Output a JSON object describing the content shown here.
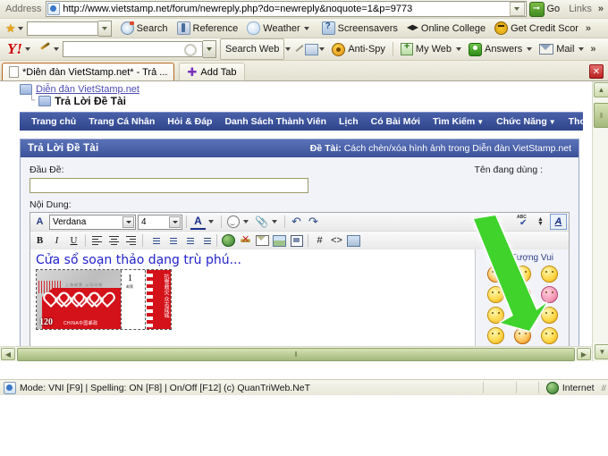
{
  "browser": {
    "address_label": "Address",
    "url": "http://www.vietstamp.net/forum/newreply.php?do=newreply&noquote=1&p=9773",
    "go_label": "Go",
    "links_label": "Links",
    "overflow_label": "»"
  },
  "links_toolbar": {
    "items": [
      {
        "label": "Search",
        "icon": "search-icon"
      },
      {
        "label": "Reference",
        "icon": "reference-icon"
      },
      {
        "label": "Weather",
        "icon": "weather-icon"
      },
      {
        "label": "Screensavers",
        "icon": "screensavers-icon"
      },
      {
        "label": "Online College",
        "icon": "graduation-cap-icon"
      },
      {
        "label": "Get Credit Scor",
        "icon": "bee-icon"
      }
    ]
  },
  "yahoo_toolbar": {
    "logo": "Y!",
    "search_placeholder": "",
    "search_value": "",
    "search_web_label": "Search Web",
    "items": [
      {
        "label": "Anti-Spy",
        "icon": "anti-spy-icon"
      },
      {
        "label": "My Web",
        "icon": "my-web-icon"
      },
      {
        "label": "Answers",
        "icon": "answers-icon"
      },
      {
        "label": "Mail",
        "icon": "mail-icon"
      }
    ],
    "overflow_label": "»"
  },
  "tabs": {
    "active_tab": "*Diễn đàn VietStamp.net* - Trả ...",
    "add_tab_label": "Add Tab",
    "close_label": "✕"
  },
  "breadcrumb": {
    "parent": "Diễn đàn VietStamp.net",
    "current": "Trả Lời Đề Tài"
  },
  "forum_nav": [
    {
      "label": "Trang chủ",
      "caret": false
    },
    {
      "label": "Trang Cá Nhân",
      "caret": false
    },
    {
      "label": "Hỏi & Đáp",
      "caret": false
    },
    {
      "label": "Danh Sách Thành Viên",
      "caret": false
    },
    {
      "label": "Lịch",
      "caret": false
    },
    {
      "label": "Có Bài Mới",
      "caret": false
    },
    {
      "label": "Tìm Kiếm",
      "caret": true
    },
    {
      "label": "Chức Năng",
      "caret": true
    },
    {
      "label": "Thoát",
      "caret": false
    }
  ],
  "panel": {
    "title": "Trả Lời Đề Tài",
    "topic_prefix": "Đề Tài:",
    "topic_name": "Cách chèn/xóa hình ảnh trong Diễn đàn VietStamp.net",
    "title_field_label": "Đầu Đề:",
    "title_field_value": "",
    "username_label": "Tên đang dùng :",
    "content_label": "Nội Dung:"
  },
  "editor": {
    "font_family": "Verdana",
    "font_size": "4",
    "toolbar_row1": [
      {
        "name": "font-style-icon",
        "glyph": "А"
      },
      {
        "name": "font-family-select",
        "glyph": ""
      },
      {
        "name": "font-size-select",
        "glyph": ""
      },
      {
        "name": "text-color-icon",
        "glyph": "A"
      },
      {
        "name": "smiley-icon",
        "glyph": ""
      },
      {
        "name": "attachment-icon",
        "glyph": "✂"
      },
      {
        "name": "undo-icon",
        "glyph": "↶"
      },
      {
        "name": "redo-icon",
        "glyph": "↷"
      }
    ],
    "toolbar_row2": [
      {
        "name": "bold-button",
        "glyph": "B"
      },
      {
        "name": "italic-button",
        "glyph": "I"
      },
      {
        "name": "underline-button",
        "glyph": "U"
      },
      {
        "name": "align-left-button",
        "glyph": ""
      },
      {
        "name": "align-center-button",
        "glyph": ""
      },
      {
        "name": "align-right-button",
        "glyph": ""
      },
      {
        "name": "ordered-list-button",
        "glyph": ""
      },
      {
        "name": "unordered-list-button",
        "glyph": ""
      },
      {
        "name": "outdent-button",
        "glyph": ""
      },
      {
        "name": "indent-button",
        "glyph": ""
      },
      {
        "name": "insert-link-button",
        "glyph": ""
      },
      {
        "name": "remove-link-button",
        "glyph": ""
      },
      {
        "name": "insert-email-button",
        "glyph": ""
      },
      {
        "name": "insert-image-button",
        "glyph": ""
      },
      {
        "name": "quote-button",
        "glyph": ""
      },
      {
        "name": "code-hash-button",
        "glyph": "#"
      },
      {
        "name": "html-code-button",
        "glyph": "<>"
      },
      {
        "name": "insert-media-button",
        "glyph": ""
      }
    ],
    "spellcheck_label": "ABC",
    "wysiwyg_label": "A",
    "content_text": "Cửa sổ soạn thảo dạng trù phú...",
    "stamp": {
      "denomination": "120",
      "country": "CHINA中国邮政",
      "margin_number": "1",
      "margin_sub": "邮票",
      "side_text": "抗雪救灾 众志成城",
      "top_text": "上海邮票 公司印制"
    }
  },
  "smilies": {
    "title": "Biểu Tượng Vui",
    "items": [
      "laugh",
      "sleepy",
      "wave",
      "sick",
      "tired",
      "angry-pink",
      "kiss",
      "dizzy",
      "smile",
      "tongue",
      "blush",
      "neutral",
      "grin",
      "wink",
      "cool"
    ]
  },
  "scrollbars": {
    "up_glyph": "▲",
    "down_glyph": "▼",
    "left_glyph": "◀",
    "right_glyph": "▶",
    "grip_glyph": "‖"
  },
  "status_bar": {
    "message": "Mode: VNI [F9] | Spelling: ON [F8] | On/Off [F12] (c) QuanTriWeb.NeT",
    "zone": "Internet"
  },
  "colors": {
    "nav_blue": "#3c539c",
    "panel_head_blue": "#4a61a8",
    "link_blue": "#4d4db5",
    "editor_text_blue": "#2222cc",
    "stamp_red": "#d4121a",
    "annotation_green": "#3fd32b",
    "scrollbar_olive": "#a3b87b"
  }
}
